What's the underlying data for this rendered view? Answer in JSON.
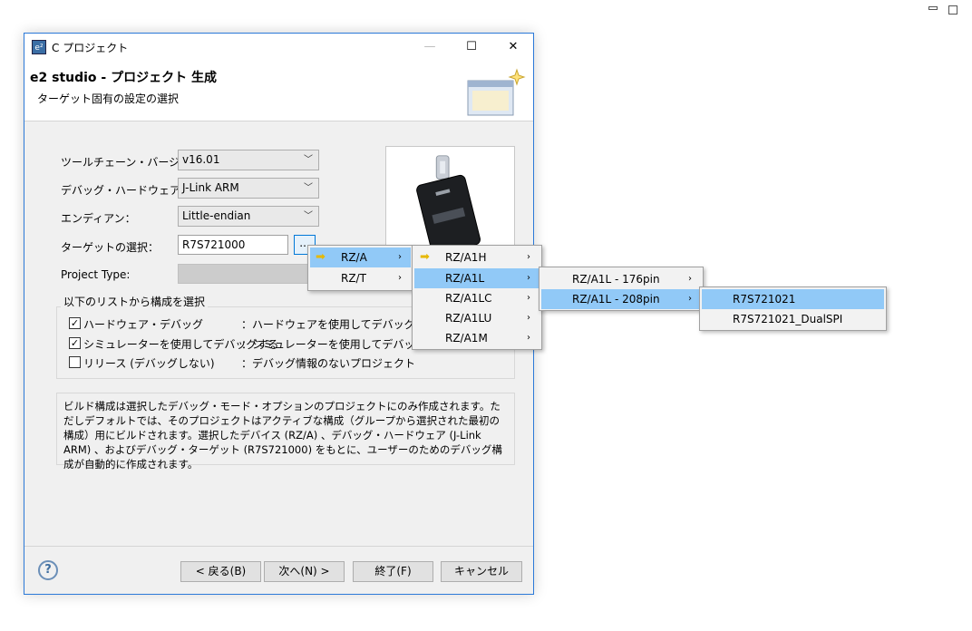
{
  "dialog": {
    "title": "C プロジェクト",
    "banner_title": "e2 studio - プロジェクト 生成",
    "banner_subtitle": "ターゲット固有の設定の選択"
  },
  "form": {
    "toolchain_label": "ツールチェーン・バージョン：",
    "toolchain_value": "v16.01",
    "debug_hw_label": "デバッグ・ハードウェア：",
    "debug_hw_value": "J-Link ARM",
    "endian_label": "エンディアン：",
    "endian_value": "Little-endian",
    "target_label": "ターゲットの選択：",
    "target_value": "R7S721000",
    "browse_label": "...",
    "project_type_label": "Project Type:"
  },
  "config_group": {
    "legend": "以下のリストから構成を選択",
    "items": [
      {
        "checked": true,
        "label": "ハードウェア・デバッグ",
        "desc": "：ハードウェアを使用してデバッグする"
      },
      {
        "checked": true,
        "label": "シミュレーターを使用してデバッグする",
        "desc": "：シミュレーターを使用してデバッグする"
      },
      {
        "checked": false,
        "label": "リリース (デバッグしない)",
        "desc": "：デバッグ情報のないプロジェクト"
      }
    ]
  },
  "info_text": "ビルド構成は選択したデバッグ・モード・オプションのプロジェクトにのみ作成されます。ただしデフォルトでは、そのプロジェクトはアクティブな構成（グループから選択された最初の構成）用にビルドされます。選択したデバイス (RZ/A) 、デバッグ・ハードウェア (J-Link ARM) 、およびデバッグ・ターゲット (R7S721000) をもとに、ユーザーのためのデバッグ構成が自動的に作成されます。",
  "buttons": {
    "help": "?",
    "back": "< 戻る(B)",
    "next": "次へ(N) >",
    "finish": "終了(F)",
    "cancel": "キャンセル"
  },
  "menus": {
    "level1": [
      "RZ/A",
      "RZ/T"
    ],
    "level2": [
      "RZ/A1H",
      "RZ/A1L",
      "RZ/A1LC",
      "RZ/A1LU",
      "RZ/A1M"
    ],
    "level3": [
      "RZ/A1L - 176pin",
      "RZ/A1L - 208pin"
    ],
    "level4": [
      "R7S721021",
      "R7S721021_DualSPI"
    ]
  },
  "colors": {
    "accent": "#2b79d8",
    "menu_highlight": "#91c9f7"
  }
}
